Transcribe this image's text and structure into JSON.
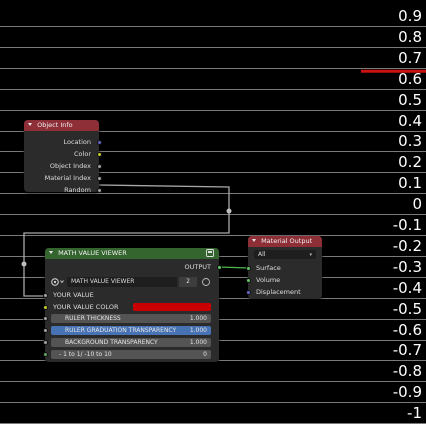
{
  "ruler": {
    "ticks": [
      "0.9",
      "0.8",
      "0.7",
      "0.6",
      "0.5",
      "0.4",
      "0.3",
      "0.2",
      "0.1",
      "0",
      "-0.1",
      "-0.2",
      "-0.3",
      "-0.4",
      "-0.5",
      "-0.6",
      "-0.7",
      "-0.8",
      "-0.9",
      "-1"
    ],
    "highlighted_value": 0.65,
    "highlight_color": "#cc1111"
  },
  "nodes": {
    "object_info": {
      "title": "Object Info",
      "outputs": [
        "Location",
        "Color",
        "Object Index",
        "Material Index",
        "Random"
      ]
    },
    "material_output": {
      "title": "Material Output",
      "target": "All",
      "inputs": [
        "Surface",
        "Volume",
        "Displacement"
      ]
    },
    "math_viewer": {
      "title": "MATH VALUE VIEWER",
      "output_label": "OUTPUT",
      "group_name": "MATH VALUE VIEWER",
      "user_count": "2",
      "inputs": {
        "your_value": "YOUR VALUE",
        "your_value_color": "YOUR VALUE COLOR",
        "ruler_thickness": {
          "label": "RULER THICKNESS",
          "value": "1.000"
        },
        "ruler_graduation_transparency": {
          "label": "RULER GRADUATION TRANSPARENCY",
          "value": "1.000"
        },
        "background_transparency": {
          "label": "BACKGROUND TRANSPARENCY",
          "value": "1.000"
        },
        "range_mode": {
          "label": "- 1 to 1/ -10 to 10",
          "value": "0"
        }
      },
      "value_color": "#c80000"
    }
  },
  "colors": {
    "header_red": "#8e2f38",
    "header_green": "#35652f",
    "socket_vector": "#6363c7",
    "socket_color": "#c7c729",
    "socket_float": "#a1a1a1",
    "socket_shader": "#63c763",
    "highlight_field": "#4772b3"
  }
}
